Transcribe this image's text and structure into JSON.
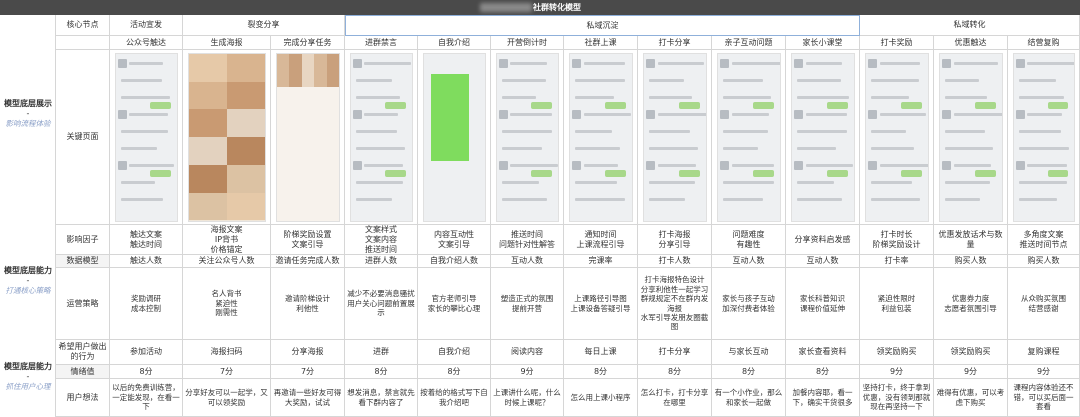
{
  "page": {
    "title": "社群转化模型"
  },
  "side": {
    "sec1_bold": "模型底层展示",
    "sec1_dash": "-",
    "sec1_sub": "影响流程体验",
    "sec2_bold": "模型底层能力",
    "sec2_dash": "-",
    "sec2_sub": "打通核心策略",
    "sec3_bold": "模型底层能力",
    "sec3_dash": "-",
    "sec3_sub": "抓住用户心理"
  },
  "header": {
    "core_label": "核心节点",
    "phases": [
      "活动宣发",
      "裂变分享",
      "私域沉淀",
      "私域转化"
    ]
  },
  "nodes": [
    "公众号触达",
    "生成海报",
    "完成分享任务",
    "进群禁言",
    "自我介绍",
    "开营倒计时",
    "社群上课",
    "打卡分享",
    "亲子互动问题",
    "家长小课堂",
    "打卡奖励",
    "优惠触达",
    "结营复购"
  ],
  "rows": {
    "page_label": "关键页面",
    "factors_label": "影响因子",
    "factors": [
      "触达文案\n触达时间",
      "海报文案\nIP背书\n价格锚定",
      "阶梯奖励设置\n文案引导",
      "文案样式\n文案内容\n推送时间",
      "内容互动性\n文案引导",
      "推送时间\n问题针对性解答",
      "通知时间\n上课流程引导",
      "打卡海报\n分享引导",
      "问题难度\n有趣性",
      "分享资料启发感",
      "打卡时长\n阶梯奖励设计",
      "优惠发放话术与数量",
      "多角度文案\n推送时间节点"
    ],
    "data_label": "数据模型",
    "data": [
      "触达人数",
      "关注公众号人数",
      "邀请任务完成人数",
      "进群人数",
      "自我介绍人数",
      "互动人数",
      "完课率",
      "打卡人数",
      "互动人数",
      "互动人数",
      "打卡率",
      "购买人数",
      "购买人数"
    ],
    "strategy_label": "运营策略",
    "strategy": [
      "奖励调研\n成本控制",
      "名人背书\n紧迫性\n刚需性",
      "邀请阶梯设计\n利他性",
      "减少不必要消息骚扰\n用户关心问题前置展示",
      "官方老师引导\n家长的攀比心理",
      "塑造正式的氛围\n提前开营",
      "上课路径引导图\n上课设备答疑引导",
      "打卡海报特色设计\n分享利他性一起学习\n群规规定不在群内发海报\n水军引导发朋友圈截图",
      "家长与孩子互动\n加深付费者体验",
      "家长科普知识\n课程价值延伸",
      "紧迫性限时\n利益包装",
      "优惠券力度\n志愿者氛围引导",
      "从众购买氛围\n结营感谢"
    ],
    "behavior_label": "希望用户做出\n的行为",
    "behavior": [
      "参加活动",
      "海报扫码",
      "分享海报",
      "进群",
      "自我介绍",
      "阅读内容",
      "每日上课",
      "打卡分享",
      "与家长互动",
      "家长查看资料",
      "领奖励购买",
      "领奖励购买",
      "复购课程"
    ],
    "emotion_label": "情绪值",
    "emotion": [
      "8分",
      "7分",
      "7分",
      "8分",
      "8分",
      "9分",
      "8分",
      "8分",
      "8分",
      "8分",
      "9分",
      "9分",
      "9分"
    ],
    "thought_label": "用户想法",
    "thoughts": [
      "以后的免费训练营，一定能发现，在看一下",
      "分享好友可以一起学，又可以领奖励",
      "再邀请一些好友可得大奖励，试试",
      "想发消息，禁言就先看下群内容了",
      "按着给的格式写下自我介绍吧",
      "上课讲什么呢，什么时候上课呢？",
      "怎么用上课小程序",
      "怎么打卡，打卡分享在哪里",
      "有一个小作业，那么和家长一起做",
      "加餐内容耶，看一下，确实干货很多",
      "坚持打卡，终于拿到优惠，没有领到那就现在再坚持一下",
      "难得有优惠，可以考虑下购买",
      "课程内容体验还不错，可以买后面一套看"
    ]
  },
  "colors": {
    "title_bg": "#4a4a4a",
    "grid_line": "#d6d6d6",
    "phase_border": "#8fb0da",
    "sub_label": "#8ba0c8",
    "chat_green": "#a8d88a",
    "intro_green": "#7fdc5e"
  }
}
